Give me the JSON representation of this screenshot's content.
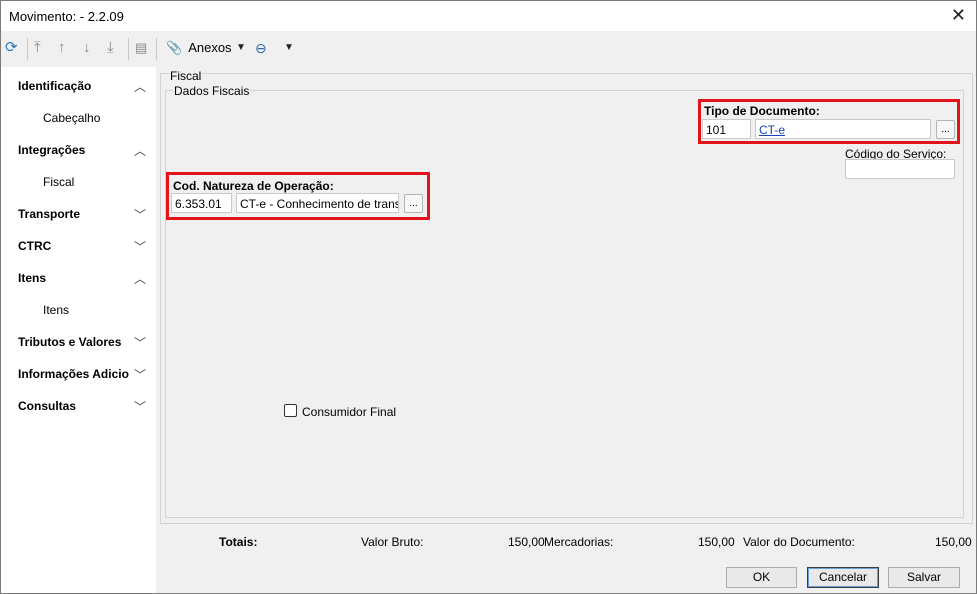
{
  "window": {
    "title": "Movimento:  - 2.2.09",
    "close_icon": "close-icon"
  },
  "toolbar": {
    "anexos_label": "Anexos"
  },
  "sidebar": {
    "items": [
      {
        "label": "Identificação",
        "expanded": true
      },
      {
        "label": "Cabeçalho"
      },
      {
        "label": "Integrações",
        "expanded": true
      },
      {
        "label": "Fiscal"
      },
      {
        "label": "Transporte",
        "expanded": false
      },
      {
        "label": "CTRC",
        "expanded": false
      },
      {
        "label": "Itens",
        "expanded": true
      },
      {
        "label": "Itens"
      },
      {
        "label": "Tributos e Valores",
        "expanded": false
      },
      {
        "label": "Informações Adicio",
        "expanded": false
      },
      {
        "label": "Consultas",
        "expanded": false
      }
    ]
  },
  "panel": {
    "title": "Fiscal",
    "group_title": "Dados Fiscais",
    "tipo_documento": {
      "label": "Tipo de Documento:",
      "code": "101",
      "description": "CT-e",
      "lookup_label": "..."
    },
    "codigo_servico": {
      "label": "Código do Serviço:",
      "value": ""
    },
    "natureza_operacao": {
      "label": "Cod. Natureza de Operação:",
      "code": "6.353.01",
      "description": "CT-e - Conhecimento de transport",
      "lookup_label": "..."
    },
    "consumidor_final": {
      "label": "Consumidor Final",
      "checked": false
    }
  },
  "totals": {
    "label": "Totais:",
    "valor_bruto_label": "Valor Bruto:",
    "valor_bruto": "150,00",
    "mercadorias_label": "Mercadorias:",
    "mercadorias": "150,00",
    "valor_documento_label": "Valor do Documento:",
    "valor_documento": "150,00"
  },
  "buttons": {
    "ok": "OK",
    "cancelar": "Cancelar",
    "salvar": "Salvar"
  },
  "colors": {
    "highlight": "#e1141c",
    "link": "#1a3fbf"
  }
}
